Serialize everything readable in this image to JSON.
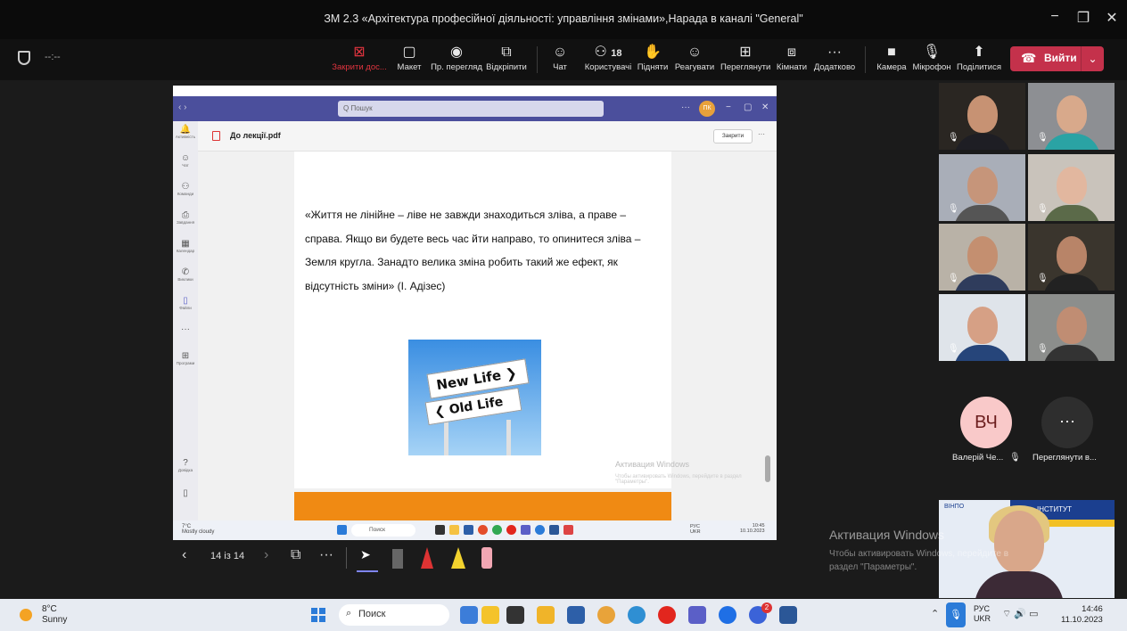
{
  "window": {
    "title": "ЗМ 2.3 «Архітектура професійної діяльності: управління змінами»,Нарада в каналі \"General\"",
    "minimize": "−",
    "maximize": "❐",
    "close": "✕"
  },
  "toolbar": {
    "timer": "--:--",
    "buttons": [
      {
        "label": "Закрити дос...",
        "icon": "⊠"
      },
      {
        "label": "Макет",
        "icon": "▢"
      },
      {
        "label": "Пр. перегляд",
        "icon": "◉"
      },
      {
        "label": "Відкріпити",
        "icon": "⧉"
      },
      {
        "label": "Чат",
        "icon": "☺"
      },
      {
        "label": "Користувачі",
        "icon": "⚇",
        "count": "18"
      },
      {
        "label": "Підняти",
        "icon": "✋"
      },
      {
        "label": "Реагувати",
        "icon": "☺"
      },
      {
        "label": "Переглянути",
        "icon": "⊞"
      },
      {
        "label": "Кімнати",
        "icon": "⧈"
      },
      {
        "label": "Додатково",
        "icon": "···"
      },
      {
        "label": "Камера",
        "icon": "■"
      },
      {
        "label": "Мікрофон",
        "icon": "🎙"
      },
      {
        "label": "Поділитися",
        "icon": "⬆"
      }
    ],
    "leave_label": "Вийти",
    "accent": "#c4314b"
  },
  "shared": {
    "search_placeholder": "Q Пошук",
    "avatar_initials": "ПК",
    "rail": [
      {
        "label": "Активність",
        "icon": "🔔"
      },
      {
        "label": "Чат",
        "icon": "☺"
      },
      {
        "label": "Команди",
        "icon": "⚇"
      },
      {
        "label": "Завдання",
        "icon": "⎙"
      },
      {
        "label": "Календар",
        "icon": "▦"
      },
      {
        "label": "Виклики",
        "icon": "✆"
      },
      {
        "label": "Файли",
        "icon": "▯"
      },
      {
        "label": "",
        "icon": "···"
      },
      {
        "label": "Програми",
        "icon": "⊞"
      },
      {
        "label": "Довідка",
        "icon": "?"
      },
      {
        "label": "",
        "icon": "▯"
      }
    ],
    "file_title": "До лекції.pdf",
    "close_label": "Закрити",
    "quote": "«Життя не лінійне – ліве не завжди знаходиться зліва, а праве – справа. Якщо ви будете весь час йти направо, то опинитеся зліва – Земля кругла. Занадто велика зміна робить такий же ефект, як відсутність зміни» (І. Адізес)",
    "sign_top": "New Life ❯",
    "sign_bottom": "❮ Old Life",
    "watermark_title": "Активация Windows",
    "watermark_text": "Чтобы активировать Windows, перейдите в раздел \"Параметры\".",
    "taskbar_weather": "7°C\nMostly cloudy",
    "taskbar_search": "Поиск",
    "taskbar_lang": "РУС\nUKR",
    "taskbar_clock": "10:45\n10.10.2023"
  },
  "share_controls": {
    "prev": "‹",
    "page": "14 із 14",
    "next": "›",
    "thumbs": "⧉",
    "more": "···"
  },
  "participants": {
    "named": [
      {
        "initials": "ВЧ",
        "name": "Валерій Че..."
      },
      {
        "initials": "···",
        "name": "Переглянути в..."
      }
    ],
    "presenter_logo": "ВІНПО",
    "presenter_band": "ІНСТИТУТ"
  },
  "watermark": {
    "title": "Активация Windows",
    "text": "Чтобы активировать Windows, перейдите в раздел \"Параметры\"."
  },
  "taskbar": {
    "temp": "8°C",
    "weather": "Sunny",
    "search": "Поиск",
    "lang1": "РУС",
    "lang2": "UKR",
    "time": "14:46",
    "date": "11.10.2023",
    "notification_badge": "2"
  }
}
